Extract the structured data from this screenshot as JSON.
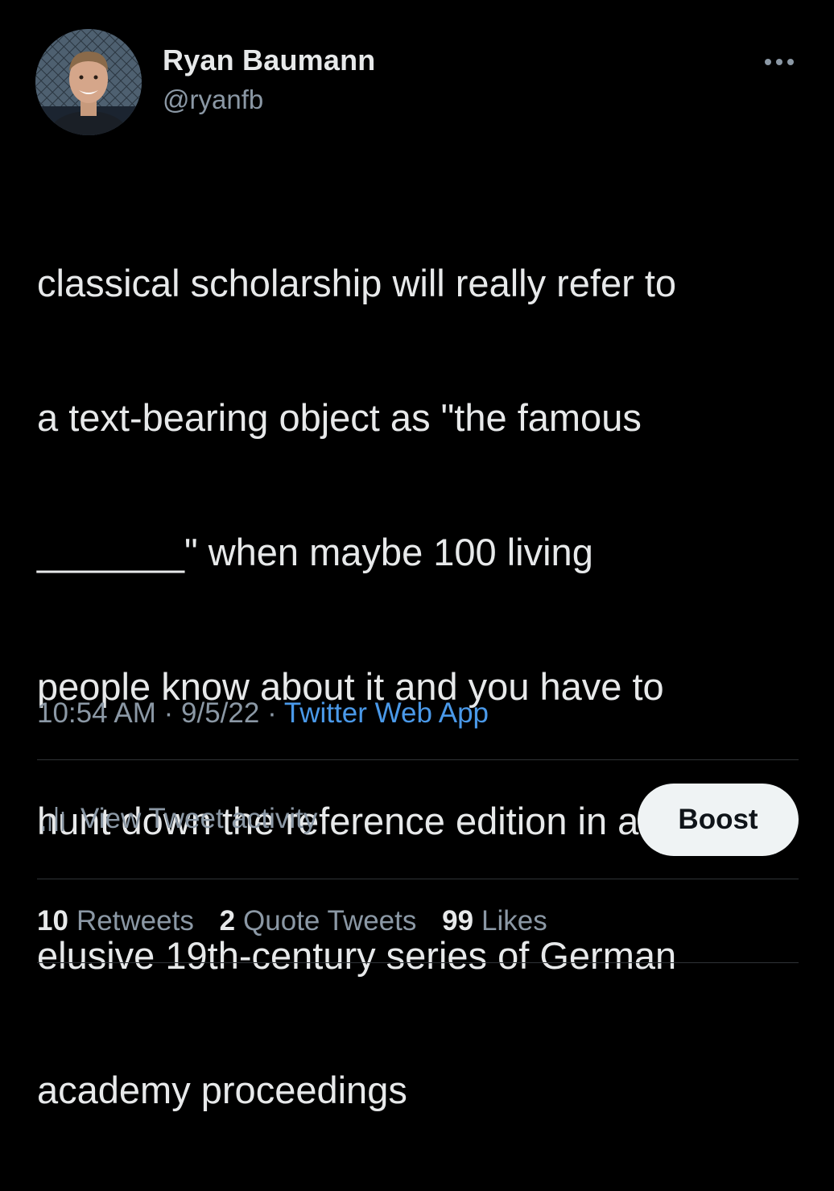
{
  "author": {
    "name": "Ryan Baumann",
    "handle": "@ryanfb",
    "avatar_icon": "profile-photo"
  },
  "more_icon": "more-horizontal-icon",
  "tweet": {
    "lines": [
      "classical scholarship will really refer to",
      "a text-bearing object as \"the famous",
      "_______\" when maybe 100 living",
      "people know about it and you have to",
      "hunt down the reference edition in an",
      "elusive 19th-century series of German",
      "academy proceedings"
    ]
  },
  "meta": {
    "time": "10:54 AM",
    "separator": "·",
    "date": "9/5/22",
    "source": "Twitter Web App"
  },
  "actions": {
    "activity_icon": "bar-chart-icon",
    "activity_label": "View Tweet activity",
    "boost_label": "Boost"
  },
  "stats": {
    "retweets_count": "10",
    "retweets_label": "Retweets",
    "quotes_count": "2",
    "quotes_label": "Quote Tweets",
    "likes_count": "99",
    "likes_label": "Likes"
  },
  "colors": {
    "background": "#000000",
    "primary_text": "#e7e9ea",
    "secondary_text": "#8b98a5",
    "link": "#4a99e9",
    "divider": "#2f3336",
    "boost_bg": "#eff3f4"
  }
}
